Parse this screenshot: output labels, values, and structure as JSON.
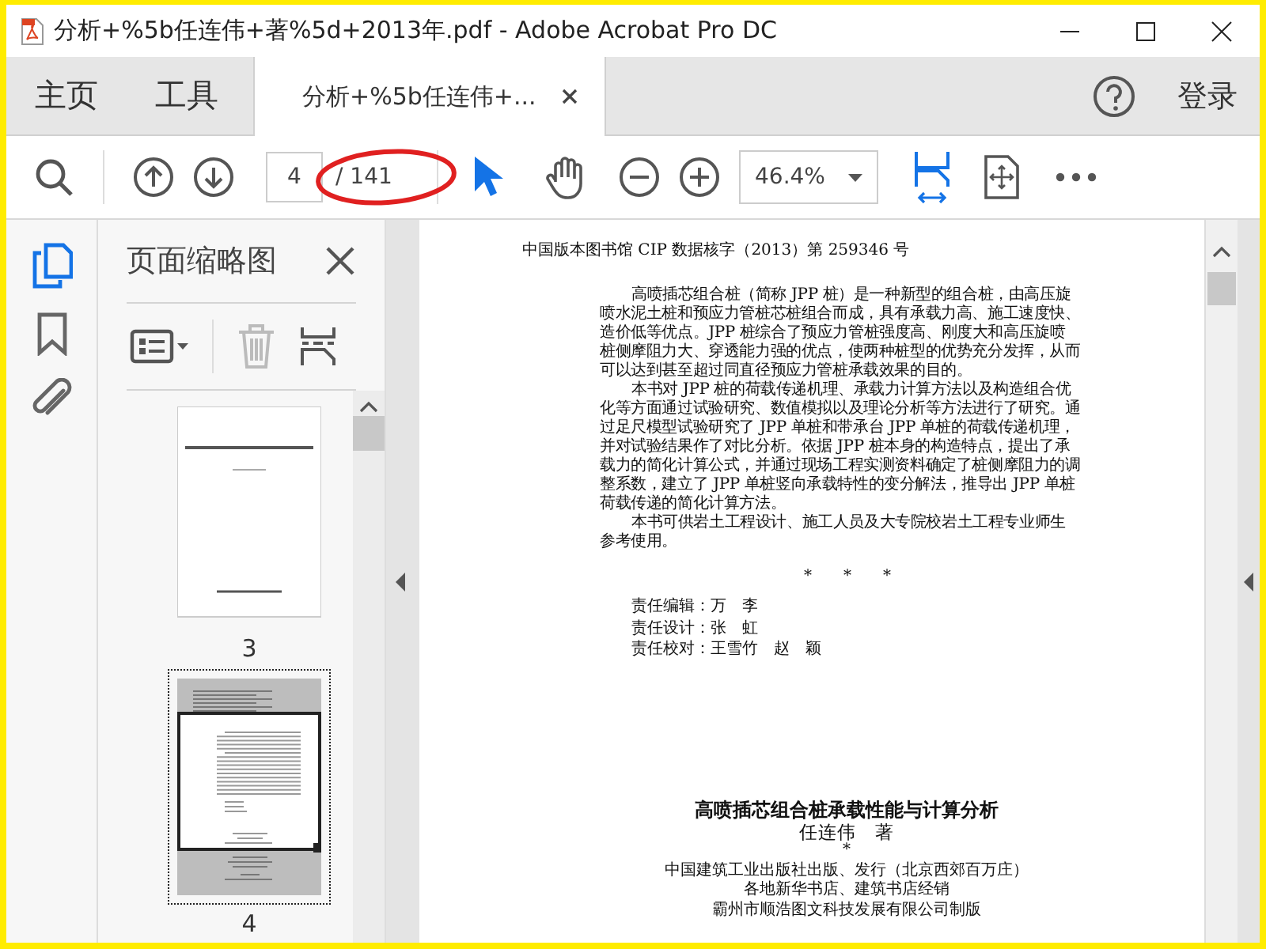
{
  "window": {
    "title": "分析+%5b任连伟+著%5d+2013年.pdf - Adobe Acrobat Pro DC"
  },
  "tabs": [
    {
      "label": "主页",
      "kind": "nav",
      "selected": false
    },
    {
      "label": "工具",
      "kind": "nav",
      "selected": false
    },
    {
      "label": "分析+%5b任连伟+...",
      "kind": "document",
      "selected": true
    }
  ],
  "sign_in": "登录",
  "toolbar": {
    "page_number": "4",
    "page_total": "/ 141",
    "zoom": "46.4%",
    "tools": [
      {
        "kind": "select",
        "selected": true
      },
      {
        "kind": "hand",
        "selected": false
      }
    ]
  },
  "rail": [
    {
      "kind": "pages",
      "selected": true
    },
    {
      "kind": "bookmarks",
      "selected": false
    },
    {
      "kind": "attachments",
      "selected": false
    }
  ],
  "panel": {
    "title": "页面缩略图",
    "delete_disabled": true,
    "thumbnails": [
      {
        "label": "3",
        "kind": "cover",
        "selected": false
      },
      {
        "label": "4",
        "kind": "text",
        "selected": true
      }
    ]
  },
  "document": {
    "cip_line": "中国版本图书馆 CIP 数据核字（2013）第 259346 号",
    "paragraphs": [
      "高喷插芯组合桩（简称 JPP 桩）是一种新型的组合桩，由高压旋喷水泥土桩和预应力管桩芯桩组合而成，具有承载力高、施工速度快、造价低等优点。JPP 桩综合了预应力管桩强度高、刚度大和高压旋喷桩侧摩阻力大、穿透能力强的优点，使两种桩型的优势充分发挥，从而可以达到甚至超过同直径预应力管桩承载效果的目的。",
      "本书对 JPP 桩的荷载传递机理、承载力计算方法以及构造组合优化等方面通过试验研究、数值模拟以及理论分析等方法进行了研究。通过足尺模型试验研究了 JPP 单桩和带承台 JPP 单桩的荷载传递机理，并对试验结果作了对比分析。依据 JPP 桩本身的构造特点，提出了承载力的简化计算公式，并通过现场工程实测资料确定了桩侧摩阻力的调整系数，建立了 JPP 单桩竖向承载特性的变分解法，推导出 JPP 单桩荷载传递的简化计算方法。",
      "本书可供岩土工程设计、施工人员及大专院校岩土工程专业师生参考使用。"
    ],
    "separator": "*　　*　　*",
    "credits": [
      "责任编辑：万　李",
      "责任设计：张　虹",
      "责任校对：王雪竹　赵　颖"
    ],
    "book_title": "高喷插芯组合桩承载性能与计算分析",
    "author": "任连伟　著",
    "mark": "*",
    "imprint": [
      "中国建筑工业出版社出版、发行（北京西郊百万庄）",
      "各地新华书店、建筑书店经销",
      "霸州市顺浩图文科技发展有限公司制版"
    ]
  }
}
